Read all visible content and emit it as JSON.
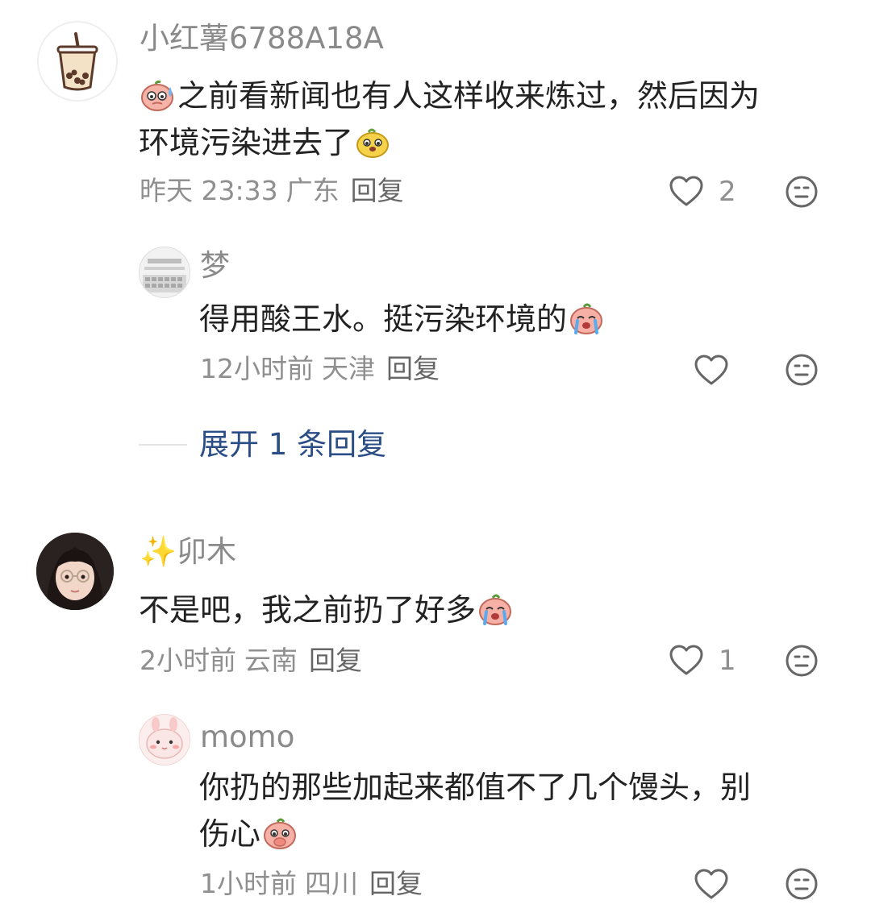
{
  "comments": [
    {
      "username": "小红薯6788A18A",
      "text_part1": "之前看新闻也有人这样收来炼过，然后因为",
      "text_part2": "环境污染进去了",
      "emoji_lead": "sweat-face-emoji",
      "emoji_tail": "yellow-doggo-emoji",
      "time": "昨天 23:33",
      "location": "广东",
      "reply_label": "回复",
      "like_count": "2",
      "avatar_icon": "bubble-tea-avatar",
      "replies": [
        {
          "username": "梦",
          "text": "得用酸王水。挺污染环境的",
          "emoji_tail": "crying-peach-emoji",
          "time": "12小时前",
          "location": "天津",
          "reply_label": "回复",
          "like_count": "",
          "avatar_icon": "keyboard-photo-avatar"
        }
      ],
      "expand_label": "展开 1 条回复"
    },
    {
      "username": "✨卯木",
      "text": "不是吧，我之前扔了好多",
      "emoji_tail": "crying-peach-emoji",
      "time": "2小时前",
      "location": "云南",
      "reply_label": "回复",
      "like_count": "1",
      "avatar_icon": "girl-photo-avatar",
      "replies": [
        {
          "username": "momo",
          "text_part1": "你扔的那些加起来都值不了几个馒头，别",
          "text_part2": "伤心",
          "emoji_tail": "shy-peach-emoji",
          "time": "1小时前",
          "location": "四川",
          "reply_label": "回复",
          "like_count": "",
          "avatar_icon": "pink-bunny-avatar"
        }
      ]
    }
  ],
  "colors": {
    "username": "#8a8a8a",
    "text": "#222222",
    "meta": "#8f8f8f",
    "expand": "#2b4d86"
  }
}
